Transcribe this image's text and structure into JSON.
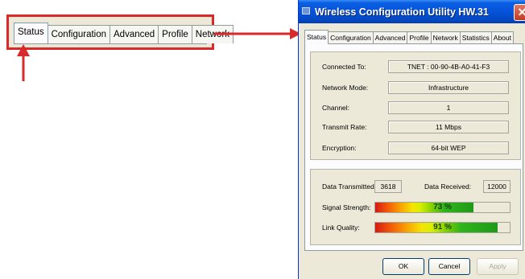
{
  "zoom": {
    "tabs": [
      "Status",
      "Configuration",
      "Advanced",
      "Profile",
      "Network"
    ]
  },
  "window": {
    "title": "Wireless Configuration Utility HW.31",
    "close_glyph": "✕",
    "tabs": [
      "Status",
      "Configuration",
      "Advanced",
      "Profile",
      "Network",
      "Statistics",
      "About"
    ]
  },
  "status": {
    "connected_to": {
      "label": "Connected To:",
      "value": "TNET : 00-90-4B-A0-41-F3"
    },
    "network_mode": {
      "label": "Network Mode:",
      "value": "Infrastructure"
    },
    "channel": {
      "label": "Channel:",
      "value": "1"
    },
    "transmit_rate": {
      "label": "Transmit Rate:",
      "value": "11 Mbps"
    },
    "encryption": {
      "label": "Encryption:",
      "value": "64-bit WEP"
    }
  },
  "stats": {
    "data_transmitted": {
      "label": "Data Transmitted:",
      "value": "3618"
    },
    "data_received": {
      "label": "Data Received:",
      "value": "12000"
    },
    "signal_strength": {
      "label": "Signal Strength:",
      "text": "73 %",
      "level": 0.73
    },
    "link_quality": {
      "label": "Link Quality:",
      "text": "91 %",
      "level": 0.91
    }
  },
  "buttons": {
    "ok": "OK",
    "cancel": "Cancel",
    "apply": "Apply"
  },
  "colors": {
    "arrow": "#d9292a",
    "title_bar": "#0553d8",
    "dialog_bg": "#ece9d8"
  }
}
